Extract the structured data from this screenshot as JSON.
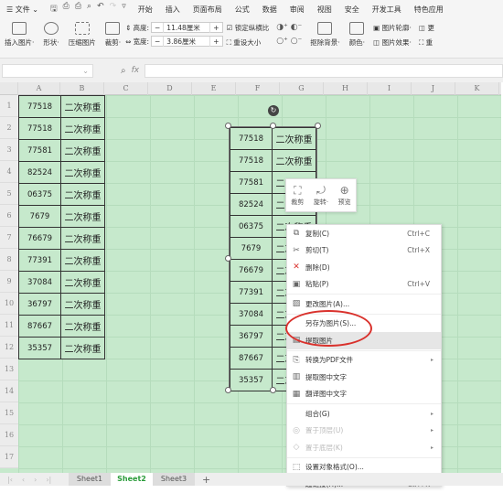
{
  "menubar": {
    "file": "文件",
    "items": [
      "开始",
      "插入",
      "页面布局",
      "公式",
      "数据",
      "审阅",
      "视图",
      "安全",
      "开发工具",
      "特色应用"
    ]
  },
  "ribbon": {
    "insert_picture": "插入图片·",
    "shape": "形状·",
    "compress": "压缩图片",
    "crop": "裁剪·",
    "height_label": "高度:",
    "height_value": "11.48厘米",
    "width_label": "宽度:",
    "width_value": "3.86厘米",
    "lock_ratio": "锁定纵横比",
    "reset_size": "重设大小",
    "remove_bg": "抠除背景·",
    "color": "颜色·",
    "outline": "图片轮廓·",
    "effects": "图片效果·",
    "more1": "更",
    "more2": "重"
  },
  "formula": {
    "fx": "fx",
    "namebox": ""
  },
  "columns": [
    "A",
    "B",
    "C",
    "D",
    "E",
    "F",
    "G",
    "H",
    "I",
    "J",
    "K"
  ],
  "rows": [
    "1",
    "2",
    "3",
    "4",
    "5",
    "6",
    "7",
    "8",
    "9",
    "10",
    "11",
    "12",
    "13",
    "14",
    "15",
    "16",
    "17"
  ],
  "table": {
    "codes": [
      "77518",
      "77518",
      "77581",
      "82524",
      "06375",
      "7679",
      "76679",
      "77391",
      "37084",
      "36797",
      "87667",
      "35357"
    ],
    "label": "二次称重"
  },
  "mini_toolbar": {
    "crop": "裁剪",
    "rotate": "旋转·",
    "preview": "预览"
  },
  "context_menu": [
    {
      "icon": "⧉",
      "label": "复制(C)",
      "shortcut": "Ctrl+C"
    },
    {
      "icon": "✂",
      "label": "剪切(T)",
      "shortcut": "Ctrl+X"
    },
    {
      "icon": "✕",
      "label": "删除(D)",
      "shortcut": ""
    },
    {
      "icon": "▣",
      "label": "粘贴(P)",
      "shortcut": "Ctrl+V"
    },
    {
      "icon": "▨",
      "label": "更改图片(A)...",
      "shortcut": ""
    },
    {
      "icon": "",
      "label": "另存为图片(S)...",
      "shortcut": ""
    },
    {
      "icon": "▤",
      "label": "提取图片",
      "shortcut": ""
    },
    {
      "icon": "⎘",
      "label": "转换为PDF文件",
      "shortcut": ""
    },
    {
      "icon": "▥",
      "label": "提取图中文字",
      "shortcut": ""
    },
    {
      "icon": "▦",
      "label": "翻译图中文字",
      "shortcut": ""
    },
    {
      "icon": "",
      "label": "组合(G)",
      "shortcut": ""
    },
    {
      "icon": "◎",
      "label": "置于顶层(U)",
      "shortcut": ""
    },
    {
      "icon": "◇",
      "label": "置于底层(K)",
      "shortcut": ""
    },
    {
      "icon": "⬚",
      "label": "设置对象格式(O)...",
      "shortcut": ""
    },
    {
      "icon": "⚭",
      "label": "超链接(H)...",
      "shortcut": "Ctrl+K"
    }
  ],
  "sheets": [
    "Sheet1",
    "Sheet2",
    "Sheet3"
  ],
  "active_sheet": "Sheet2",
  "colors": {
    "sheet_bg": "#c6e9cc",
    "active_tab": "#2b9c3b",
    "highlight_ellipse": "#d9312c"
  }
}
